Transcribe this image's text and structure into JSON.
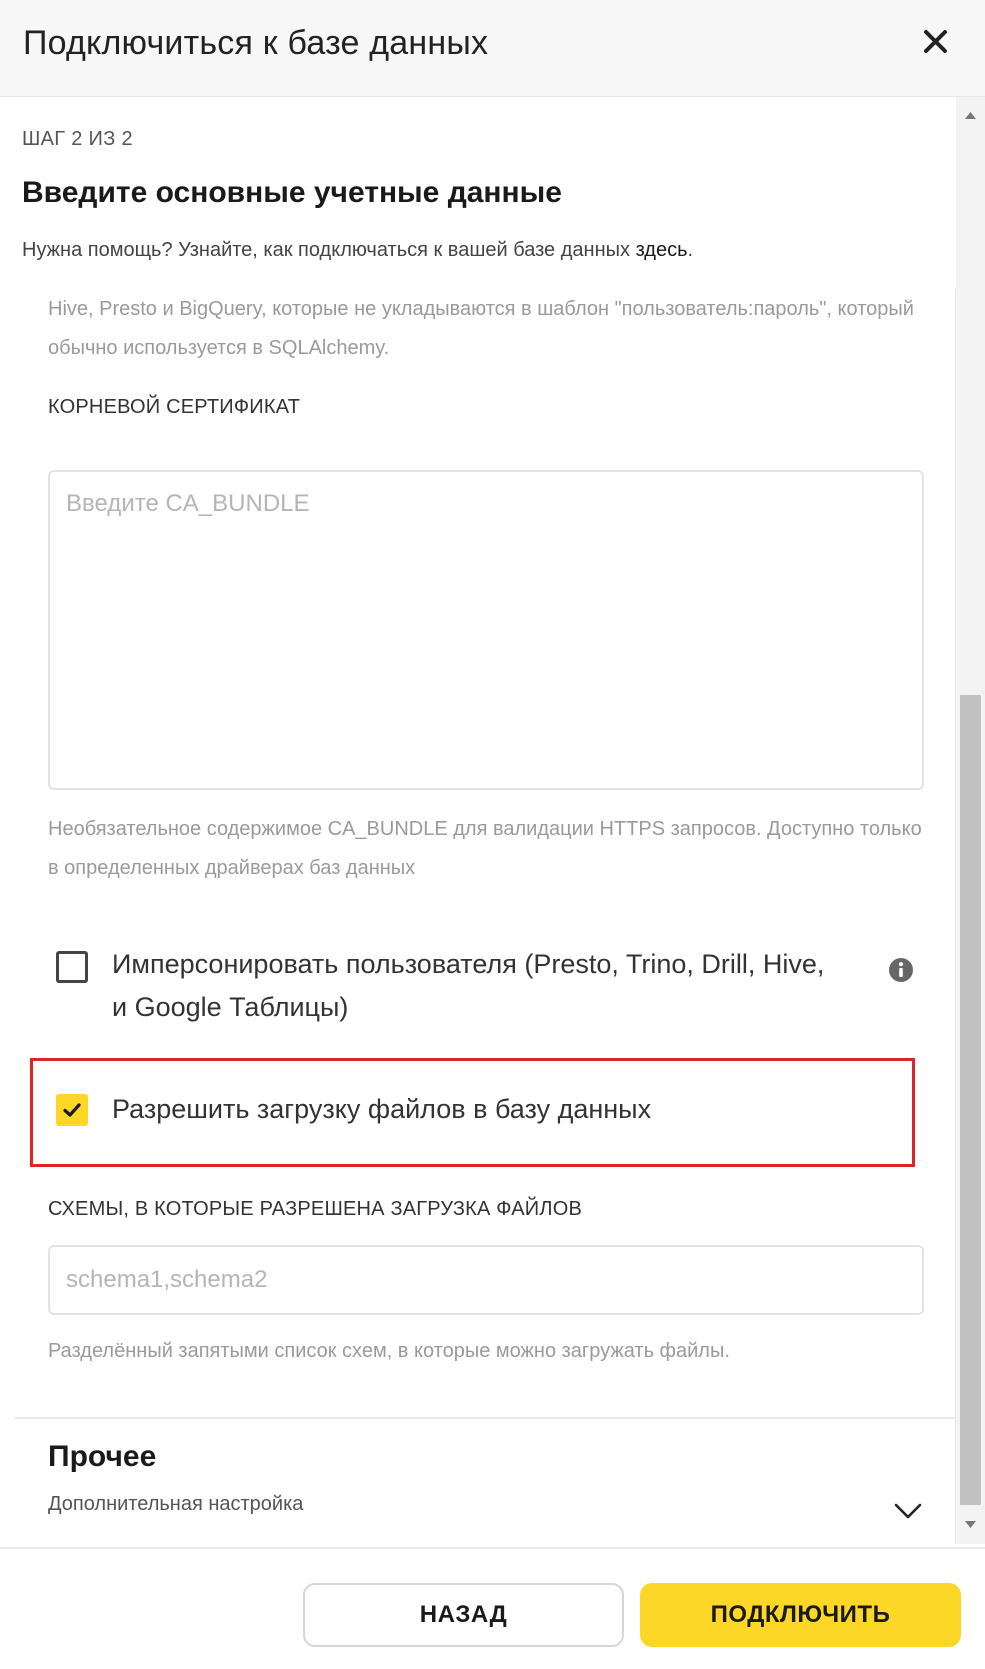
{
  "header": {
    "title": "Подключиться к базе данных"
  },
  "step": {
    "label": "ШАГ 2 ИЗ 2",
    "title": "Введите основные учетные данные",
    "help_prefix": "Нужна помощь? Узнайте, как подключаться к вашей базе данных ",
    "help_link": "здесь",
    "help_suffix": "."
  },
  "prev_description": "Hive, Presto и BigQuery, которые не укладываются в шаблон \"пользователь:пароль\", который обычно используется в SQLAlchemy.",
  "root_cert": {
    "label": "КОРНЕВОЙ СЕРТИФИКАТ",
    "placeholder": "Введите CA_BUNDLE",
    "value": "",
    "description": "Необязательное содержимое CA_BUNDLE для валидации HTTPS запросов. Доступно только в определенных драйверах баз данных"
  },
  "impersonate": {
    "label": "Имперсонировать пользователя (Presto, Trino, Drill, Hive, и Google Таблицы)",
    "checked": false,
    "info_icon": "info-circle-icon"
  },
  "allow_upload": {
    "label": "Разрешить загрузку файлов в базу данных",
    "checked": true,
    "highlight_color": "#e02329"
  },
  "schemas": {
    "label": "СХЕМЫ, В КОТОРЫЕ РАЗРЕШЕНА ЗАГРУЗКА ФАЙЛОВ",
    "placeholder": "schema1,schema2",
    "value": "",
    "description": "Разделённый запятыми список схем, в которые можно загружать файлы."
  },
  "other": {
    "title": "Прочее",
    "subtitle": "Дополнительная настройка"
  },
  "footer": {
    "back_label": "НАЗАД",
    "connect_label": "ПОДКЛЮЧИТЬ"
  },
  "colors": {
    "accent": "#fcd728",
    "highlight": "#e02329"
  }
}
